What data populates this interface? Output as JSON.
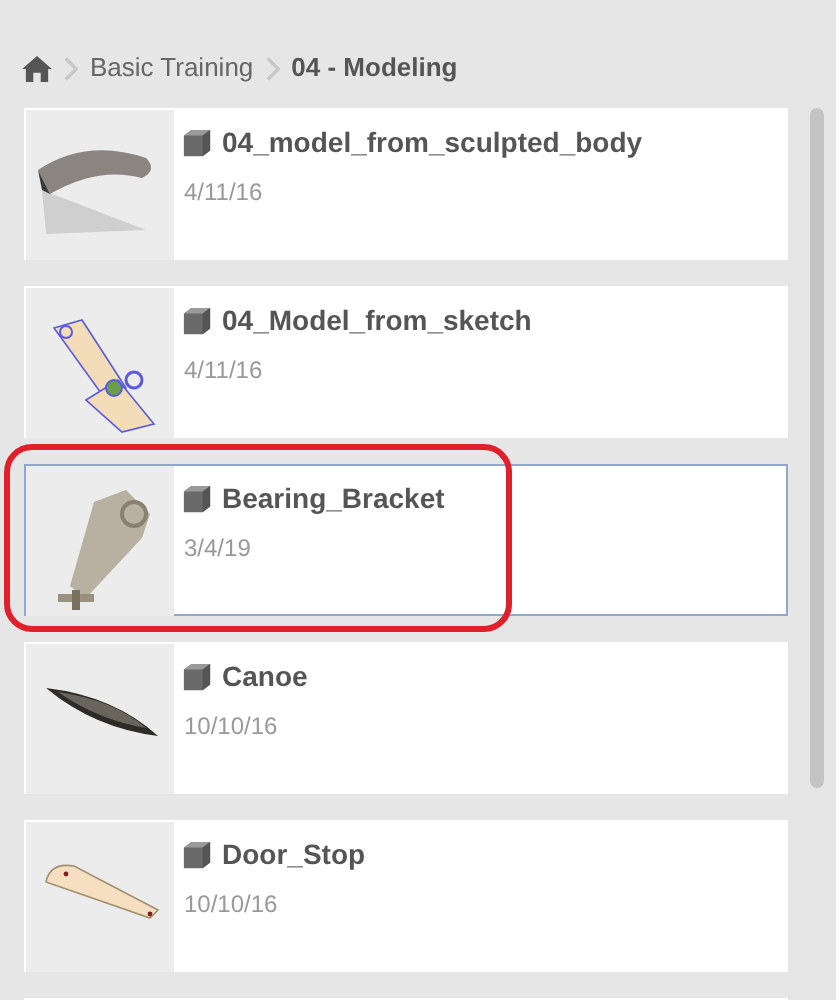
{
  "breadcrumb": [
    {
      "label": "Basic Training",
      "current": false
    },
    {
      "label": "04 - Modeling",
      "current": true
    }
  ],
  "items": [
    {
      "name": "04_model_from_sculpted_body",
      "date": "4/11/16",
      "kind": "sculpt",
      "selected": false,
      "circled": false
    },
    {
      "name": "04_Model_from_sketch",
      "date": "4/11/16",
      "kind": "sketch",
      "selected": false,
      "circled": false
    },
    {
      "name": "Bearing_Bracket",
      "date": "3/4/19",
      "kind": "bracket",
      "selected": true,
      "circled": true
    },
    {
      "name": "Canoe",
      "date": "10/10/16",
      "kind": "canoe",
      "selected": false,
      "circled": false
    },
    {
      "name": "Door_Stop",
      "date": "10/10/16",
      "kind": "wedge",
      "selected": false,
      "circled": false
    }
  ]
}
